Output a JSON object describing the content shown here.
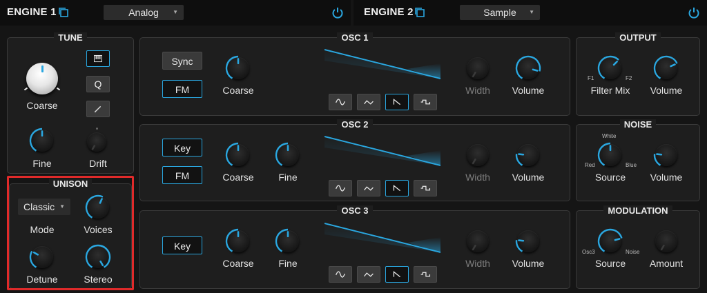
{
  "engine1": {
    "title": "ENGINE 1",
    "type": "Analog"
  },
  "engine2": {
    "title": "ENGINE 2",
    "type": "Sample"
  },
  "tune": {
    "title": "TUNE",
    "coarse_label": "Coarse",
    "fine_label": "Fine",
    "drift_label": "Drift",
    "q_label": "Q"
  },
  "unison": {
    "title": "UNISON",
    "mode_value": "Classic",
    "mode_label": "Mode",
    "voices_label": "Voices",
    "detune_label": "Detune",
    "stereo_label": "Stereo"
  },
  "osc1": {
    "title": "OSC 1",
    "sync_label": "Sync",
    "fm_label": "FM",
    "coarse_label": "Coarse",
    "width_label": "Width",
    "volume_label": "Volume"
  },
  "osc2": {
    "title": "OSC 2",
    "key_label": "Key",
    "fm_label": "FM",
    "coarse_label": "Coarse",
    "fine_label": "Fine",
    "width_label": "Width",
    "volume_label": "Volume"
  },
  "osc3": {
    "title": "OSC 3",
    "key_label": "Key",
    "coarse_label": "Coarse",
    "fine_label": "Fine",
    "width_label": "Width",
    "volume_label": "Volume"
  },
  "output": {
    "title": "OUTPUT",
    "f1": "F1",
    "f2": "F2",
    "filter_mix_label": "Filter Mix",
    "volume_label": "Volume"
  },
  "noise": {
    "title": "NOISE",
    "white": "White",
    "red": "Red",
    "blue": "Blue",
    "source_label": "Source",
    "volume_label": "Volume"
  },
  "modulation": {
    "title": "MODULATION",
    "osc3": "Osc3",
    "noise": "Noise",
    "source_label": "Source",
    "amount_label": "Amount"
  },
  "knob_values": {
    "tune_fine": 0.5,
    "tune_drift": 0.0,
    "unison_voices": 0.58,
    "unison_detune": 0.3,
    "unison_stereo": 1.0,
    "osc1_coarse": 0.5,
    "osc1_width": 0.0,
    "osc1_volume": 0.85,
    "osc2_coarse": 0.5,
    "osc2_fine": 0.5,
    "osc2_width": 0.0,
    "osc2_volume": 0.22,
    "osc3_coarse": 0.5,
    "osc3_fine": 0.5,
    "osc3_width": 0.0,
    "osc3_volume": 0.22,
    "output_filter_mix": 0.65,
    "output_volume": 0.72,
    "noise_source": 0.5,
    "noise_volume": 0.22,
    "mod_source": 0.75,
    "mod_amount": 0.0
  },
  "colors": {
    "accent": "#2aa7e0",
    "highlight": "#e02a2a",
    "panel_bg": "#1e1e1e"
  },
  "icons": [
    "copy-icon",
    "power-icon",
    "piano-keys-icon",
    "pencil-icon",
    "sine-wave-icon",
    "triangle-wave-icon",
    "saw-wave-icon",
    "square-wave-icon"
  ]
}
